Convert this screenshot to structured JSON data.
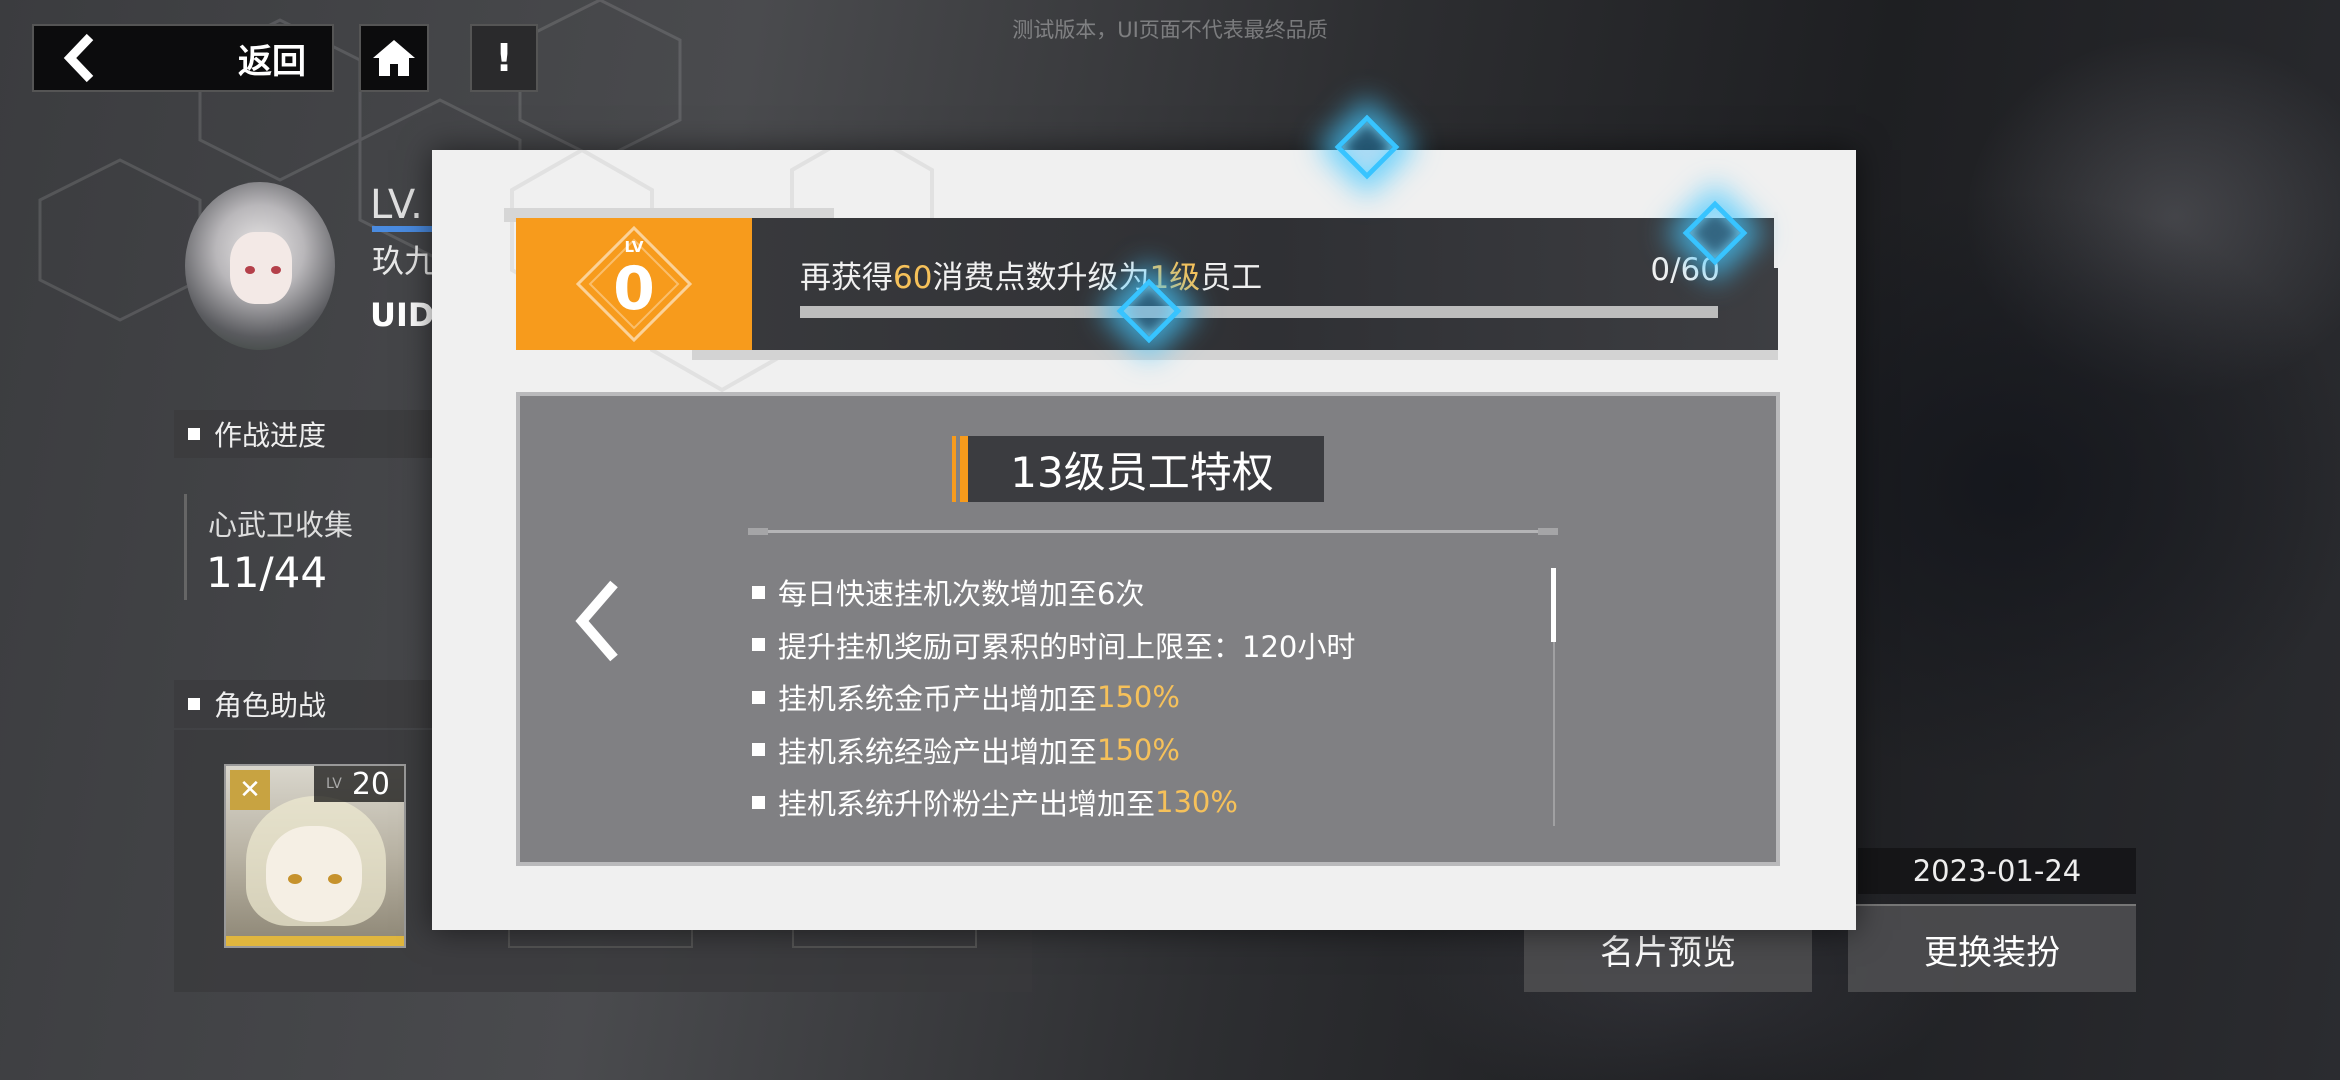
{
  "watermark": "测试版本，UI页面不代表最终品质",
  "topbar": {
    "back_label": "返回",
    "icons": [
      "chevron-left-icon",
      "home-icon",
      "alert-icon"
    ],
    "info_glyph": "!"
  },
  "profile": {
    "level_prefix": "LV.",
    "name_partial": "玖九",
    "uid_label": "UID"
  },
  "sections": {
    "combat_progress": "作战进度",
    "collection_label": "心武卫收集",
    "collection_value": "11/44",
    "support": "角色助战",
    "support_level_prefix": "LV",
    "support_level": "20"
  },
  "right": {
    "date": "2023-01-24",
    "card_preview_label": "名片预览",
    "change_outfit_label": "更换装扮"
  },
  "modal": {
    "level_lv": "LV",
    "level_value": "0",
    "msg_before": "再获得",
    "msg_points": "60",
    "msg_middle": "消费点数升级为",
    "msg_level": "1级",
    "msg_after": "员工",
    "progress_text": "0/60",
    "progress_fraction": 0,
    "privilege_title": "13级员工特权",
    "privileges": [
      {
        "text": "每日快速挂机次数增加至6次",
        "highlight": ""
      },
      {
        "text": "提升挂机奖励可累积的时间上限至：120小时",
        "highlight": ""
      },
      {
        "text": "挂机系统金币产出增加至",
        "highlight": "150%"
      },
      {
        "text": "挂机系统经验产出增加至",
        "highlight": "150%"
      },
      {
        "text": "挂机系统升阶粉尘产出增加至",
        "highlight": "130%"
      }
    ]
  },
  "colors": {
    "accent_orange": "#f79b1c",
    "highlight_gold": "#f6c15a",
    "glow_blue": "#38c4ff"
  }
}
